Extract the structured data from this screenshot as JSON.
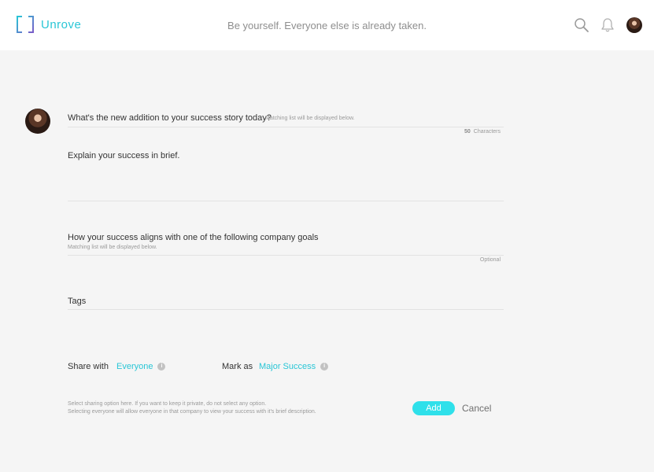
{
  "header": {
    "app_name": "Unrove",
    "tagline": "Be yourself. Everyone else is already taken.",
    "icons": [
      "search-icon",
      "bell-icon",
      "avatar"
    ]
  },
  "form": {
    "question1": {
      "label": "What's the new addition to your success story today?",
      "hint": "Matching list will be displayed below.",
      "counter_value": "50",
      "counter_unit": "Characters"
    },
    "question2": {
      "label": "Explain your success in brief."
    },
    "question3": {
      "label": "How your success aligns with one of the following company goals",
      "hint": "Matching list will be displayed below.",
      "optional": "Optional"
    },
    "tags": {
      "label": "Tags"
    },
    "share": {
      "label": "Share with",
      "value": "Everyone"
    },
    "mark": {
      "label": "Mark as",
      "value": "Major Success"
    },
    "note_line1": "Select sharing option here. If you want to keep it private, do not select any option.",
    "note_line2": "Selecting everyone will allow everyone in that company to view your success with it's brief description.",
    "add_label": "Add",
    "cancel_label": "Cancel"
  },
  "colors": {
    "accent": "#29c6d6",
    "button": "#2fe0ea",
    "background": "#f5f5f5"
  }
}
